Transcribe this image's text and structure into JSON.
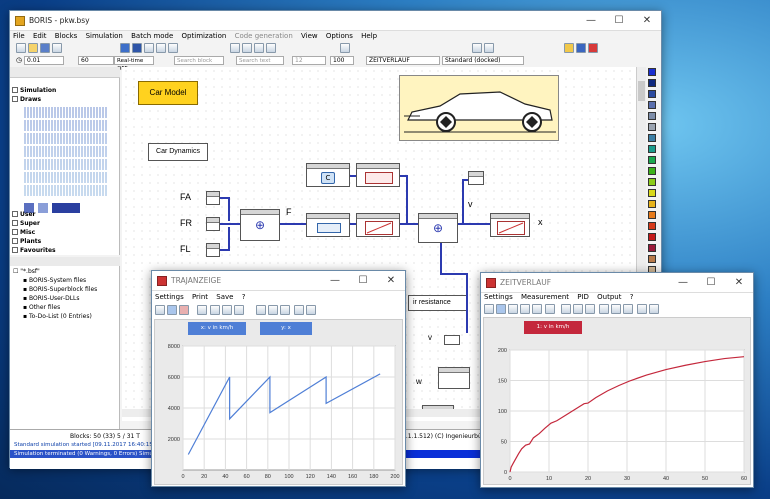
{
  "main": {
    "title": "BORIS - pkw.bsy",
    "menu": [
      "File",
      "Edit",
      "Blocks",
      "Simulation",
      "Batch mode",
      "Optimization",
      "Code generation",
      "View",
      "Options",
      "Help"
    ],
    "step": "0.01",
    "steps": "60",
    "realtime": "Real-time OFF",
    "search_block": "Search block",
    "search_text": "Search text",
    "font_size": "12",
    "zoom": "100",
    "block_select": "ZEITVERLAUF",
    "dock_select": "Standard (docked)"
  },
  "library": {
    "categories": [
      "Simulation",
      "Draws",
      "User",
      "Super",
      "Misc",
      "Plants",
      "Favourites"
    ]
  },
  "tree": {
    "root": "\"*.bsf\"",
    "items": [
      "BORIS-System files",
      "BORIS-Superblock files",
      "BORIS-User-DLLs",
      "Other files",
      "To-Do-List (0 Entries)"
    ]
  },
  "status": {
    "blocks": "Blocks: 50 (33) 5 / 31 T",
    "zero": "0",
    "msg1": "Standard simulation started    [09.11.2017 16:40:15]",
    "msg2": "Simulation terminated (0 Warnings, 0 Errors)   Simul",
    "copyright": "3.1.1.512)  (C) Ingenieurbüro"
  },
  "diagram": {
    "car_model": "Car Model",
    "car_dynamics": "Car Dynamics",
    "fa": "FA",
    "fr": "FR",
    "fl": "FL",
    "f": "F",
    "v": "v",
    "x": "x",
    "v2": "v",
    "w": "w",
    "air": "ir resistance"
  },
  "traj": {
    "title": "TRAJANZEIGE",
    "menu": [
      "Settings",
      "Print",
      "Save",
      "?"
    ],
    "legend": [
      "x: v in km/h",
      "y: x"
    ],
    "chart_data": {
      "type": "line",
      "xlim": [
        0,
        200
      ],
      "ylim": [
        0,
        8000
      ],
      "xticks": [
        0,
        20,
        40,
        60,
        80,
        100,
        120,
        140,
        160,
        180,
        200
      ],
      "yticks": [
        2000,
        4000,
        6000,
        8000
      ],
      "series": [
        {
          "name": "x: v in km/h",
          "color": "#4f7fd6",
          "x": [
            5,
            44,
            44,
            82,
            82,
            135,
            135,
            186
          ],
          "y": [
            1000,
            6000,
            3300,
            6000,
            3700,
            6000,
            4300,
            6200
          ]
        }
      ],
      "grid": true
    }
  },
  "zeit": {
    "title": "ZEITVERLAUF",
    "menu": [
      "Settings",
      "Measurement",
      "PID",
      "Output",
      "?"
    ],
    "legend": [
      "1: v in km/h"
    ],
    "chart_data": {
      "type": "line",
      "xlim": [
        0,
        60
      ],
      "ylim": [
        0,
        200
      ],
      "xticks": [
        0,
        10,
        20,
        30,
        40,
        50,
        60
      ],
      "yticks": [
        0,
        50,
        100,
        150,
        200
      ],
      "series": [
        {
          "name": "1: v in km/h",
          "color": "#c4283c",
          "x": [
            0,
            0.3,
            0.8,
            1.5,
            2.2,
            3,
            4,
            5,
            6,
            7.5,
            9,
            10.5,
            12,
            14,
            16,
            18,
            19,
            20,
            22,
            25,
            28,
            31,
            35,
            40,
            45,
            50,
            55,
            60
          ],
          "y": [
            0,
            8,
            14,
            22,
            30,
            38,
            44,
            46,
            56,
            63,
            72,
            80,
            84,
            92,
            100,
            108,
            112,
            113,
            122,
            133,
            142,
            150,
            159,
            168,
            175,
            181,
            186,
            189
          ]
        }
      ],
      "grid": true
    }
  },
  "colors": [
    "#1a2fd0",
    "#102a80",
    "#2b4a9e",
    "#5a6fae",
    "#7c8ca8",
    "#9aa3b0",
    "#3c7fa5",
    "#1a9c8c",
    "#1aa84e",
    "#3db21a",
    "#8ccc1a",
    "#d8d81a",
    "#e6b21a",
    "#e67a1a",
    "#d63a1a",
    "#c41a1a",
    "#9a1a3a",
    "#b87a4a",
    "#cdb494",
    "#e8dcc0"
  ]
}
